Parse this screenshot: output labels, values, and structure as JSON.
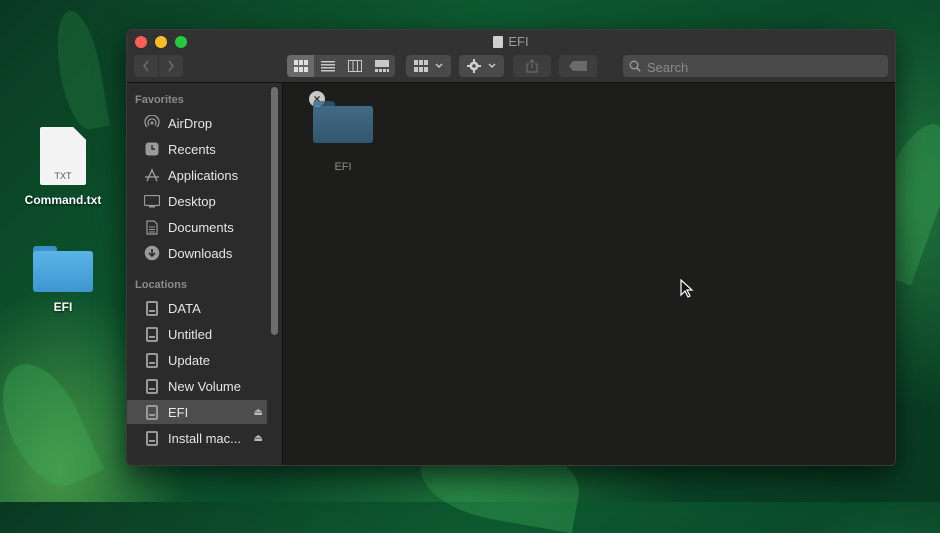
{
  "desktop": {
    "items": [
      {
        "name": "Command.txt",
        "badge": "TXT"
      },
      {
        "name": "EFI"
      }
    ]
  },
  "window": {
    "title": "EFI",
    "search": {
      "placeholder": "Search",
      "value": ""
    },
    "sidebar": {
      "favorites_heading": "Favorites",
      "favorites": [
        {
          "label": "AirDrop",
          "icon": "airdrop-icon"
        },
        {
          "label": "Recents",
          "icon": "clock-icon"
        },
        {
          "label": "Applications",
          "icon": "applications-icon"
        },
        {
          "label": "Desktop",
          "icon": "desktop-icon"
        },
        {
          "label": "Documents",
          "icon": "document-icon"
        },
        {
          "label": "Downloads",
          "icon": "download-icon"
        }
      ],
      "locations_heading": "Locations",
      "locations": [
        {
          "label": "DATA",
          "icon": "drive-icon"
        },
        {
          "label": "Untitled",
          "icon": "drive-icon"
        },
        {
          "label": "Update",
          "icon": "drive-icon"
        },
        {
          "label": "New Volume",
          "icon": "drive-icon"
        },
        {
          "label": "EFI",
          "icon": "drive-icon",
          "selected": true,
          "eject": true
        },
        {
          "label": "Install mac...",
          "icon": "drive-icon",
          "eject": true
        }
      ]
    },
    "content": {
      "items": [
        {
          "name": "EFI",
          "type": "folder"
        }
      ]
    }
  },
  "colors": {
    "close": "#fe5f57",
    "minimize": "#febc2e",
    "zoom": "#28c840",
    "folder": "#5bb4e8"
  }
}
